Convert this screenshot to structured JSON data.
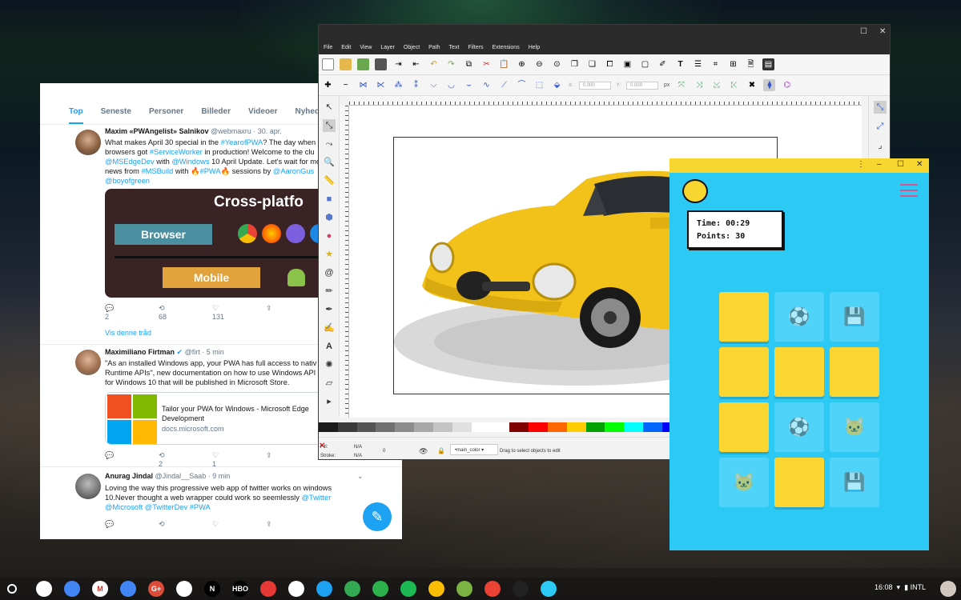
{
  "twitter": {
    "tabs": [
      "Top",
      "Seneste",
      "Personer",
      "Billeder",
      "Videoer",
      "Nyheder"
    ],
    "tweets": [
      {
        "name": "Maxim «PWAngelist» Salnikov",
        "handle": "@webmaxru",
        "time": "· 30. apr.",
        "line1_a": "What makes April 30 special in the ",
        "line1_link": "#YearofPWA",
        "line1_b": "? The day when",
        "line2_a": "browsers got ",
        "line2_link": "#ServiceWorker",
        "line2_b": " in production! Welcome to the clu",
        "line3_link1": "@MSEdgeDev",
        "line3_a": " with ",
        "line3_link2": "@Windows",
        "line3_b": " 10 April Update. Let's wait for mo",
        "line4_a": "news from ",
        "line4_link1": "#MSBuild",
        "line4_b": " with 🔥",
        "line4_link2": "#PWA",
        "line4_c": "🔥 sessions by ",
        "line4_link3": "@AaronGus",
        "line5_link": "@boyofgreen",
        "card_title": "Cross-platfo",
        "card_browser": "Browser",
        "card_mobile": "Mobile",
        "replies": "2",
        "retweets": "68",
        "likes": "131",
        "thread": "Vis denne tråd"
      },
      {
        "name": "Maximiliano Firtman",
        "handle": "@firt",
        "time": "· 5 min",
        "line1": "\"As an installed Windows app, your PWA has full access to nativ",
        "line2": "Runtime APIs\", new documentation on how to use Windows API",
        "line3": "for Windows 10 that will be published in Microsoft Store.",
        "link_title": "Tailor your PWA for Windows - Microsoft Edge",
        "link_title2": "Development",
        "link_domain": "docs.microsoft.com",
        "replies": "",
        "retweets": "2",
        "likes": "1"
      },
      {
        "name": "Anurag Jindal",
        "handle": "@Jindal__Saab",
        "time": "· 9 min",
        "line1": "Loving the way this progressive web app of twitter works on windows",
        "line2_a": "10.Never thought a web wrapper could work so seemlessly  ",
        "line2_link": "@Twitter",
        "line3_link1": "@Microsoft",
        "line3_link2": "@TwitterDev",
        "line3_link3": "#PWA"
      }
    ]
  },
  "inkscape": {
    "menu": [
      "File",
      "Edit",
      "View",
      "Layer",
      "Object",
      "Path",
      "Text",
      "Filters",
      "Extensions",
      "Help"
    ],
    "coord_x": "0.000",
    "coord_y": "0.000",
    "unit": "px",
    "fill_label": "Fill:",
    "stroke_label": "Stroke:",
    "fill_value": "N/A",
    "stroke_value": "N/A",
    "opacity": "0",
    "layer": "•main_color",
    "status": "Drag to select objects to edit",
    "palette": [
      "#1a1a1a",
      "#3a3a3a",
      "#555555",
      "#707070",
      "#8c8c8c",
      "#a8a8a8",
      "#c4c4c4",
      "#e0e0e0",
      "#ffffff",
      "#ffffff",
      "#800000",
      "#ff0000",
      "#ff6600",
      "#ffcc00",
      "#00a000",
      "#00ff00",
      "#00ffff",
      "#0066ff",
      "#0000ff",
      "#8000ff",
      "#ff00ff",
      "#ff66cc",
      "#ffcccc",
      "#ffe0c0",
      "#c0e0ff",
      "#804000",
      "#c08040",
      "#404080",
      "#8080c0",
      "#c0c0ff"
    ]
  },
  "game": {
    "time_label": "Time:",
    "time_value": "00:29",
    "points_label": "Points:",
    "points_value": "30",
    "accent": "#2dc9f5",
    "card_color": "#fbd632",
    "cards": [
      {
        "state": "closed",
        "icon": ""
      },
      {
        "state": "open",
        "icon": "⚽"
      },
      {
        "state": "open",
        "icon": "💾"
      },
      {
        "state": "closed",
        "icon": ""
      },
      {
        "state": "closed",
        "icon": ""
      },
      {
        "state": "closed",
        "icon": ""
      },
      {
        "state": "closed",
        "icon": ""
      },
      {
        "state": "open",
        "icon": "⚽"
      },
      {
        "state": "open",
        "icon": "🐱"
      },
      {
        "state": "open",
        "icon": "🐱"
      },
      {
        "state": "closed",
        "icon": ""
      },
      {
        "state": "open",
        "icon": "💾"
      }
    ]
  },
  "shelf": {
    "time": "16:08",
    "ime": "INTL",
    "apps": [
      {
        "name": "chrome",
        "color": "#ffffff",
        "label": ""
      },
      {
        "name": "files",
        "color": "#4285f4",
        "label": ""
      },
      {
        "name": "gmail",
        "color": "#ffffff",
        "label": "M"
      },
      {
        "name": "docs",
        "color": "#4285f4",
        "label": ""
      },
      {
        "name": "google-plus",
        "color": "#dd4b39",
        "label": "G+"
      },
      {
        "name": "drive",
        "color": "#ffffff",
        "label": ""
      },
      {
        "name": "netflix",
        "color": "#000000",
        "label": "N"
      },
      {
        "name": "hbo",
        "color": "#000000",
        "label": "HBO"
      },
      {
        "name": "movies",
        "color": "#e53935",
        "label": ""
      },
      {
        "name": "play-store",
        "color": "#ffffff",
        "label": ""
      },
      {
        "name": "twitter",
        "color": "#1da1f2",
        "label": ""
      },
      {
        "name": "maps",
        "color": "#34a853",
        "label": ""
      },
      {
        "name": "feedly",
        "color": "#2bb24c",
        "label": ""
      },
      {
        "name": "spotify",
        "color": "#1db954",
        "label": ""
      },
      {
        "name": "keep",
        "color": "#fbbc04",
        "label": ""
      },
      {
        "name": "photos",
        "color": "#7cb342",
        "label": ""
      },
      {
        "name": "pinwheel",
        "color": "#ea4335",
        "label": ""
      },
      {
        "name": "inkscape",
        "color": "#222222",
        "label": ""
      },
      {
        "name": "memory-game",
        "color": "#2dc9f5",
        "label": ""
      }
    ]
  }
}
